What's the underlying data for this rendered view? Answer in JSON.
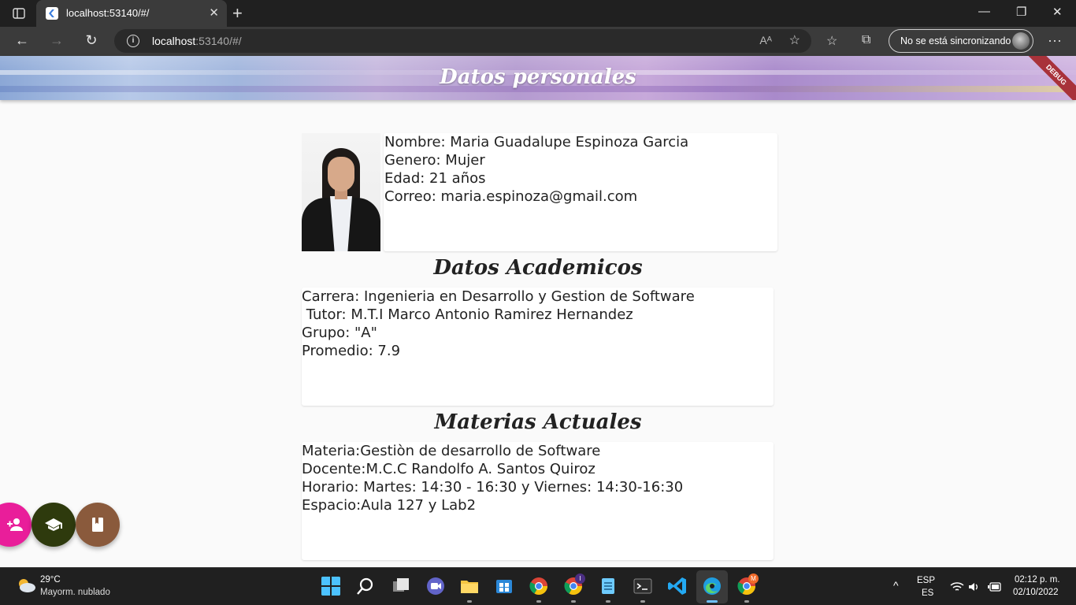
{
  "browser": {
    "tab_title": "localhost:53140/#/",
    "url_host": "localhost",
    "url_rest": ":53140/#/",
    "sync_label": "No se está sincronizando",
    "read_aloud": "Aᴬ"
  },
  "appbar": {
    "title": "Datos personales",
    "debug_label": "DEBUG"
  },
  "personal": {
    "nombre": "Nombre: Maria Guadalupe Espinoza Garcia",
    "genero": "Genero: Mujer",
    "edad": "Edad: 21 años",
    "correo": "Correo: maria.espinoza@gmail.com"
  },
  "academicos": {
    "title": "Datos Academicos",
    "carrera": "Carrera: Ingenieria en Desarrollo y Gestion de Software",
    "tutor": " Tutor: M.T.I Marco Antonio Ramirez Hernandez",
    "grupo": "Grupo: \"A\"",
    "promedio": "Promedio: 7.9"
  },
  "materias": {
    "title": "Materias Actuales",
    "materia": "Materia:Gestiòn de desarrollo de Software",
    "docente": "Docente:M.C.C Randolfo A. Santos Quiroz",
    "horario": "Horario: Martes: 14:30 - 16:30 y Viernes: 14:30-16:30",
    "espacio": "Espacio:Aula 127 y Lab2"
  },
  "fabs": [
    {
      "icon": "person-add-icon",
      "color": "#e91e9a"
    },
    {
      "icon": "school-icon",
      "color": "#2e3a0d"
    },
    {
      "icon": "book-icon",
      "color": "#8a5a3c"
    }
  ],
  "taskbar": {
    "temperature": "29°C",
    "condition": "Mayorm. nublado",
    "lang_top": "ESP",
    "lang_bottom": "ES",
    "time": "02:12 p. m.",
    "date": "02/10/2022",
    "badge_i": "I",
    "badge_m": "M"
  }
}
